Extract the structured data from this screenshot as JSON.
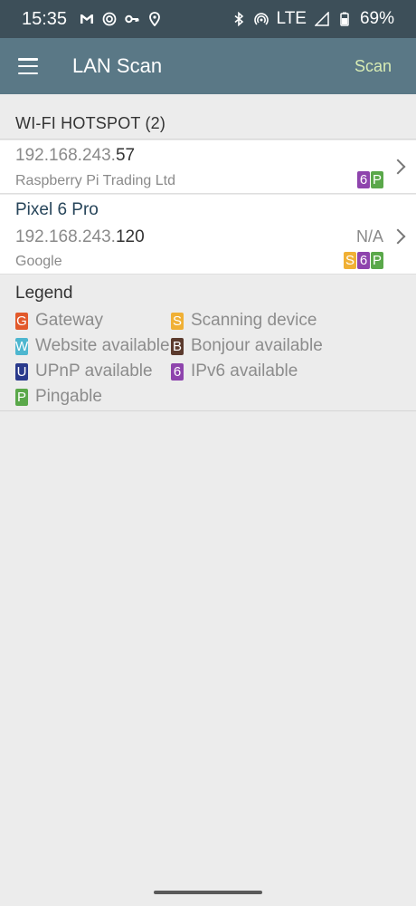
{
  "status_bar": {
    "time": "15:35",
    "left_icons": [
      "gmail-icon",
      "vpn-icon",
      "key-icon",
      "location-icon"
    ],
    "right_icons": [
      "bluetooth-icon",
      "hotspot-icon"
    ],
    "network": "LTE",
    "battery": "69%"
  },
  "app_bar": {
    "title": "LAN Scan",
    "scan_label": "Scan"
  },
  "section": {
    "header": "WI-FI HOTSPOT (2)"
  },
  "devices": [
    {
      "ip_prefix": "192.168.243.",
      "ip_suffix": "57",
      "vendor": "Raspberry Pi Trading Ltd",
      "badges": [
        "6",
        "P"
      ]
    },
    {
      "name": "Pixel 6 Pro",
      "ip_prefix": "192.168.243.",
      "ip_suffix": "120",
      "status": "N/A",
      "vendor": "Google",
      "badges": [
        "S",
        "6",
        "P"
      ]
    }
  ],
  "legend": {
    "title": "Legend",
    "items": [
      {
        "letter": "G",
        "label": "Gateway",
        "color": "#e2592b"
      },
      {
        "letter": "S",
        "label": "Scanning device",
        "color": "#f0b035"
      },
      {
        "letter": "W",
        "label": "Website available",
        "color": "#4db6cf"
      },
      {
        "letter": "B",
        "label": "Bonjour available",
        "color": "#5b3a2d"
      },
      {
        "letter": "U",
        "label": "UPnP available",
        "color": "#2a3a8c"
      },
      {
        "letter": "6",
        "label": "IPv6 available",
        "color": "#8e44ad"
      },
      {
        "letter": "P",
        "label": "Pingable",
        "color": "#5aa84a"
      }
    ]
  }
}
